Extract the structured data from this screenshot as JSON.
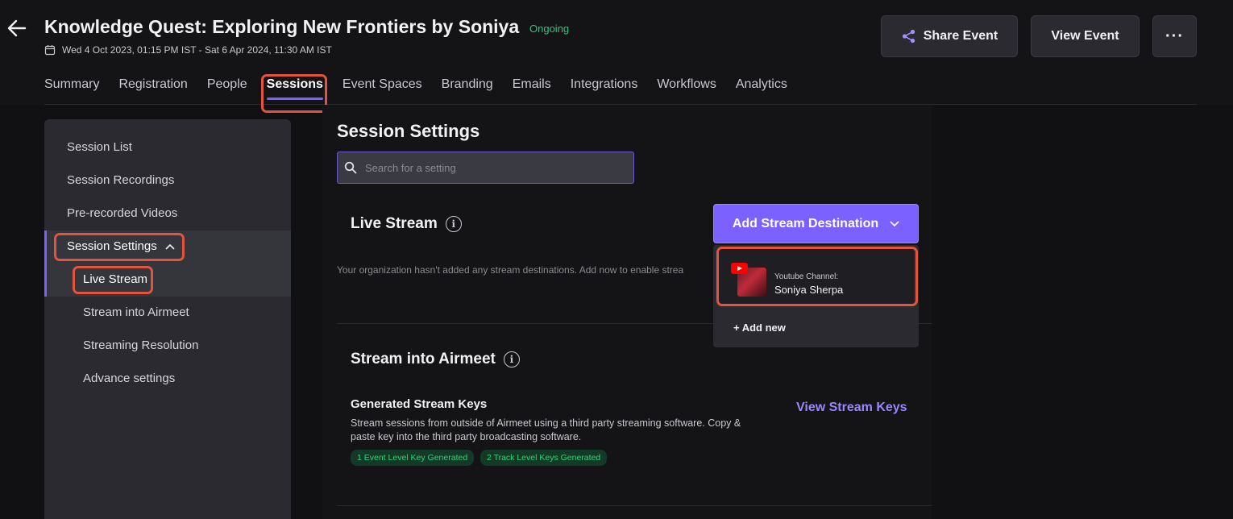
{
  "header": {
    "title": "Knowledge Quest: Exploring New Frontiers by Soniya",
    "status": "Ongoing",
    "date_range": "Wed 4 Oct 2023, 01:15 PM IST - Sat 6 Apr 2024, 11:30 AM IST",
    "share_label": "Share Event",
    "view_label": "View Event",
    "more_label": "···"
  },
  "tabs": [
    {
      "label": "Summary"
    },
    {
      "label": "Registration"
    },
    {
      "label": "People"
    },
    {
      "label": "Sessions"
    },
    {
      "label": "Event Spaces"
    },
    {
      "label": "Branding"
    },
    {
      "label": "Emails"
    },
    {
      "label": "Integrations"
    },
    {
      "label": "Workflows"
    },
    {
      "label": "Analytics"
    }
  ],
  "sidebar": {
    "items": [
      {
        "label": "Session List"
      },
      {
        "label": "Session Recordings"
      },
      {
        "label": "Pre-recorded Videos"
      },
      {
        "label": "Session Settings"
      },
      {
        "label": "Live Stream"
      },
      {
        "label": "Stream into Airmeet"
      },
      {
        "label": "Streaming Resolution"
      },
      {
        "label": "Advance settings"
      }
    ]
  },
  "main": {
    "title": "Session Settings",
    "search_placeholder": "Search for a setting",
    "live_stream": {
      "title": "Live Stream",
      "empty_message": "Your organization hasn't added any stream destinations. Add now to enable strea",
      "add_button": "Add Stream Destination",
      "dropdown": {
        "channel_label": "Youtube Channel:",
        "channel_name": "Soniya Sherpa",
        "add_new": "+ Add new"
      }
    },
    "stream_into_airmeet": {
      "title": "Stream into Airmeet",
      "keys_title": "Generated Stream Keys",
      "keys_desc": "Stream sessions from outside of Airmeet using a third party streaming software. Copy & paste key into the third party broadcasting software.",
      "badge1": "1 Event Level Key Generated",
      "badge2": "2 Track Level Keys Generated",
      "view_keys": "View Stream Keys"
    }
  }
}
